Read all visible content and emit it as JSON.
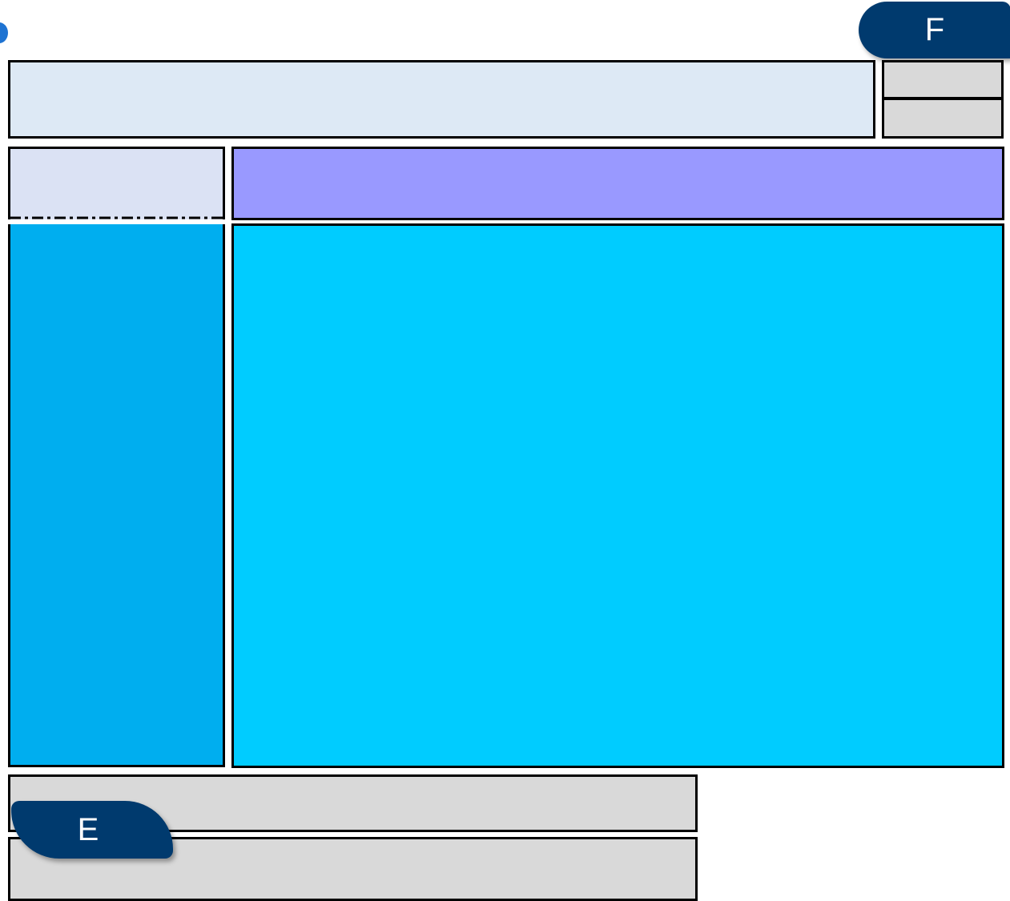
{
  "tabs": {
    "top_right_label": "F",
    "bottom_left_label": "E"
  },
  "colors": {
    "header_bg": "#dde9f5",
    "side_small_bg": "#d9d9d9",
    "sidebar_top_bg": "#dbe2f4",
    "sidebar_main_bg": "#00aeef",
    "title_bar_bg": "#9999ff",
    "content_bg": "#00ccff",
    "footer_bg": "#d9d9d9",
    "tab_bg": "#003a6e",
    "dot_color": "#1e73d2"
  }
}
